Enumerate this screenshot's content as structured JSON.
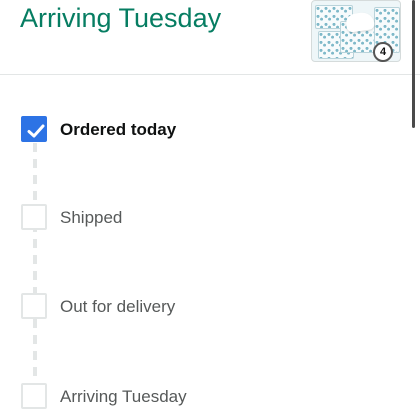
{
  "header": {
    "title": "Arriving Tuesday",
    "item_count": "4",
    "accent_color": "#067d62"
  },
  "progress": {
    "completed_color": "#2d73e5",
    "steps": [
      {
        "label": "Ordered today",
        "completed": true
      },
      {
        "label": "Shipped",
        "completed": false
      },
      {
        "label": "Out for delivery",
        "completed": false
      },
      {
        "label": "Arriving Tuesday",
        "completed": false
      }
    ]
  },
  "icons": {
    "check": "checkmark-icon",
    "product": "tissue-box-image"
  }
}
